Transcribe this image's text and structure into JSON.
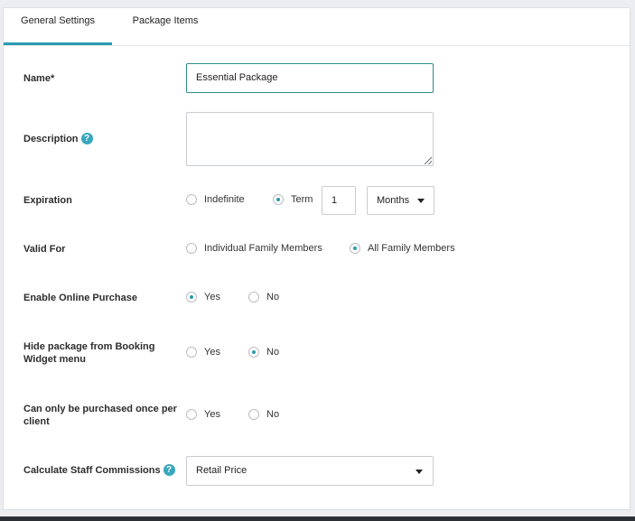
{
  "tabs": [
    {
      "label": "General Settings",
      "active": true
    },
    {
      "label": "Package Items",
      "active": false
    }
  ],
  "fields": {
    "name": {
      "label": "Name*",
      "value": "Essential Package"
    },
    "description": {
      "label": "Description",
      "value": ""
    },
    "expiration": {
      "label": "Expiration",
      "options": [
        {
          "label": "Indefinite",
          "checked": false
        },
        {
          "label": "Term",
          "checked": true
        }
      ],
      "term_value": "1",
      "term_unit": "Months"
    },
    "valid_for": {
      "label": "Valid For",
      "options": [
        {
          "label": "Individual Family Members",
          "checked": false
        },
        {
          "label": "All Family Members",
          "checked": true
        }
      ]
    },
    "online_purchase": {
      "label": "Enable Online Purchase",
      "options": [
        {
          "label": "Yes",
          "checked": true
        },
        {
          "label": "No",
          "checked": false
        }
      ]
    },
    "hide_booking": {
      "label": "Hide package from Booking Widget menu",
      "options": [
        {
          "label": "Yes",
          "checked": false
        },
        {
          "label": "No",
          "checked": true
        }
      ]
    },
    "purchase_once": {
      "label": "Can only be purchased once per client",
      "options": [
        {
          "label": "Yes",
          "checked": false
        },
        {
          "label": "No",
          "checked": false
        }
      ]
    },
    "staff_commissions": {
      "label": "Calculate Staff Commissions",
      "value": "Retail Price"
    }
  },
  "help_glyph": "?",
  "colors": {
    "accent": "#2a9bb0",
    "focus_border": "#2e8f86",
    "help_icon": "#3aa7c0"
  }
}
